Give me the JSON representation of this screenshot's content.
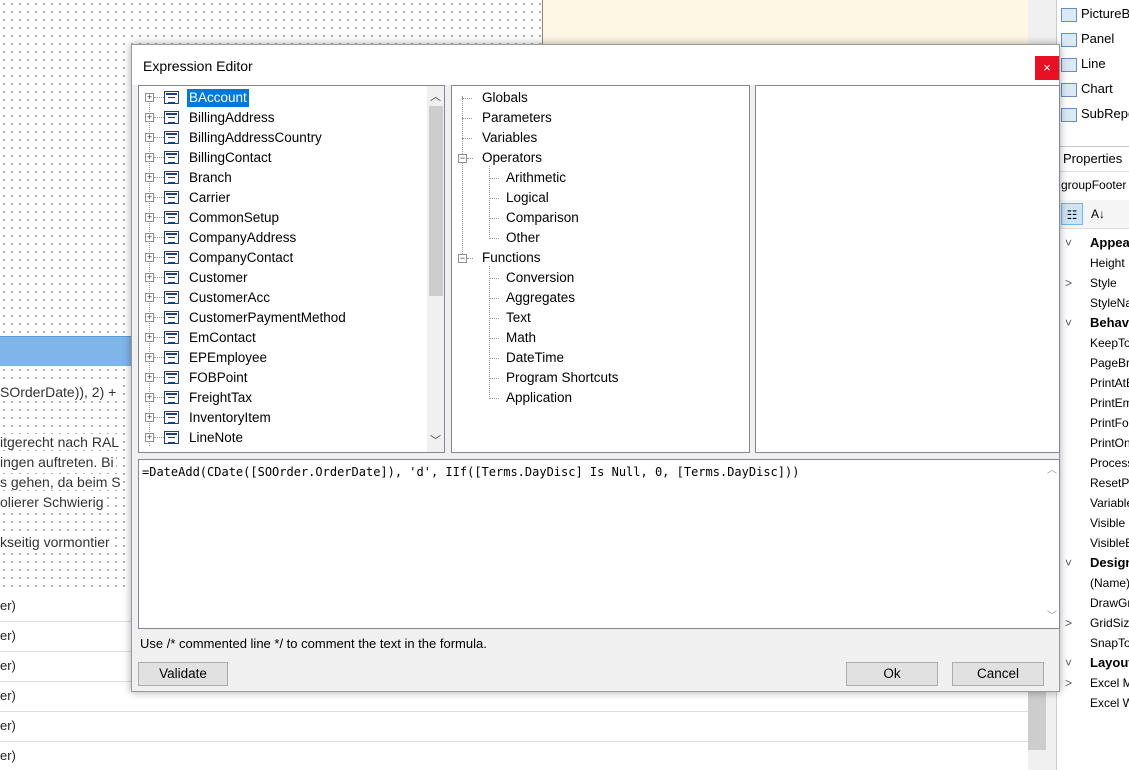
{
  "background": {
    "fragments": [
      "SOrderDate)), 2) +",
      "itgerecht nach RAL",
      "ingen auftreten. Bi",
      "s gehen, da beim S",
      "olierer Schwierig",
      "kseitig vormontier"
    ],
    "rows": [
      "er)",
      "er)",
      "er)",
      "er)",
      "er)",
      "er)"
    ]
  },
  "toolbox": {
    "items": [
      {
        "label": "PictureBox",
        "icon": "picture-icon"
      },
      {
        "label": "Panel",
        "icon": "panel-icon"
      },
      {
        "label": "Line",
        "icon": "line-icon"
      },
      {
        "label": "Chart",
        "icon": "chart-icon"
      },
      {
        "label": "SubReport",
        "icon": "subreport-icon"
      }
    ]
  },
  "properties": {
    "header": "Properties",
    "object": "groupFooter",
    "rows": [
      {
        "label": "Appearance",
        "category": true,
        "toggle": "˅"
      },
      {
        "label": "Height",
        "category": false,
        "toggle": ""
      },
      {
        "label": "Style",
        "category": false,
        "toggle": ">"
      },
      {
        "label": "StyleName",
        "category": false,
        "toggle": ""
      },
      {
        "label": "Behavior",
        "category": true,
        "toggle": "˅"
      },
      {
        "label": "KeepTogether",
        "category": false,
        "toggle": ""
      },
      {
        "label": "PageBreak",
        "category": false,
        "toggle": ""
      },
      {
        "label": "PrintAtBottom",
        "category": false,
        "toggle": ""
      },
      {
        "label": "PrintEmpty",
        "category": false,
        "toggle": ""
      },
      {
        "label": "PrintForEach",
        "category": false,
        "toggle": ""
      },
      {
        "label": "PrintOn",
        "category": false,
        "toggle": ""
      },
      {
        "label": "ProcessOrder",
        "category": false,
        "toggle": ""
      },
      {
        "label": "ResetPage",
        "category": false,
        "toggle": ""
      },
      {
        "label": "Variables",
        "category": false,
        "toggle": ""
      },
      {
        "label": "Visible",
        "category": false,
        "toggle": ""
      },
      {
        "label": "VisibleExpr",
        "category": false,
        "toggle": ""
      },
      {
        "label": "Design",
        "category": true,
        "toggle": "˅"
      },
      {
        "label": "(Name)",
        "category": false,
        "toggle": ""
      },
      {
        "label": "DrawGrid",
        "category": false,
        "toggle": ""
      },
      {
        "label": "GridSize",
        "category": false,
        "toggle": ">"
      },
      {
        "label": "SnapToGrid",
        "category": false,
        "toggle": ""
      },
      {
        "label": "Layout",
        "category": true,
        "toggle": "˅"
      },
      {
        "label": "Excel Mode",
        "category": false,
        "toggle": ">"
      },
      {
        "label": "Excel Width",
        "category": false,
        "toggle": ""
      }
    ]
  },
  "dialog": {
    "title": "Expression Editor",
    "close_glyph": "×",
    "fields": [
      "BAccount",
      "BillingAddress",
      "BillingAddressCountry",
      "BillingContact",
      "Branch",
      "Carrier",
      "CommonSetup",
      "CompanyAddress",
      "CompanyContact",
      "Customer",
      "CustomerAcc",
      "CustomerPaymentMethod",
      "EmContact",
      "EPEmployee",
      "FOBPoint",
      "FreightTax",
      "InventoryItem",
      "LineNote"
    ],
    "selected_field": "BAccount",
    "tree": [
      {
        "label": "Globals",
        "level": 0,
        "expandable": false
      },
      {
        "label": "Parameters",
        "level": 0,
        "expandable": false
      },
      {
        "label": "Variables",
        "level": 0,
        "expandable": false
      },
      {
        "label": "Operators",
        "level": 0,
        "expandable": true
      },
      {
        "label": "Arithmetic",
        "level": 1,
        "expandable": false
      },
      {
        "label": "Logical",
        "level": 1,
        "expandable": false
      },
      {
        "label": "Comparison",
        "level": 1,
        "expandable": false
      },
      {
        "label": "Other",
        "level": 1,
        "expandable": false
      },
      {
        "label": "Functions",
        "level": 0,
        "expandable": true
      },
      {
        "label": "Conversion",
        "level": 1,
        "expandable": false
      },
      {
        "label": "Aggregates",
        "level": 1,
        "expandable": false
      },
      {
        "label": "Text",
        "level": 1,
        "expandable": false
      },
      {
        "label": "Math",
        "level": 1,
        "expandable": false
      },
      {
        "label": "DateTime",
        "level": 1,
        "expandable": false
      },
      {
        "label": "Program Shortcuts",
        "level": 1,
        "expandable": false
      },
      {
        "label": "Application",
        "level": 1,
        "expandable": false
      }
    ],
    "expression": "=DateAdd(CDate([SOOrder.OrderDate]), 'd', IIf([Terms.DayDisc] Is Null, 0, [Terms.DayDisc]))",
    "hint": "Use /* commented line */ to comment the text in the formula.",
    "validate_label": "Validate",
    "ok_label": "Ok",
    "cancel_label": "Cancel"
  }
}
